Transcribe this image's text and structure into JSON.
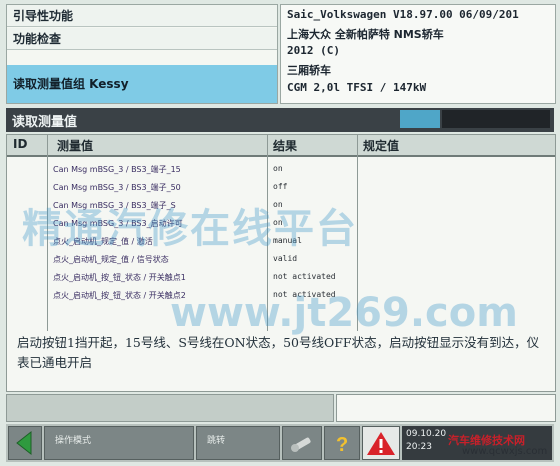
{
  "header": {
    "left": {
      "row1": "引导性功能",
      "row2": "功能检查",
      "row3": "读取测量值组 Kessy"
    },
    "right": {
      "line1": "Saic_Volkswagen  V18.97.00 06/09/201",
      "line2": "上海大众 全新帕萨特 NMS轿车",
      "line3": "2012 (C)",
      "line4": "三厢轿车",
      "line5": "CGM 2,0l TFSI / 147kW"
    }
  },
  "titlebar": {
    "title": "读取测量值"
  },
  "table": {
    "headers": {
      "id": "ID",
      "measure": "测量值",
      "result": "结果",
      "spec": "规定值"
    },
    "rows": [
      {
        "measure": "Can Msg mBSG_3 / BS3_端子_15",
        "result": "on"
      },
      {
        "measure": "Can Msg mBSG_3 / BS3_端子_50",
        "result": "off"
      },
      {
        "measure": "Can Msg mBSG_3 / BS3_端子_S",
        "result": "on"
      },
      {
        "measure": "Can Msg mBSG_3 / BS3_启动许可",
        "result": "on"
      },
      {
        "measure": "点火_启动机_规定_值 / 激活",
        "result": "manual"
      },
      {
        "measure": "点火_启动机_规定_值 / 信号状态",
        "result": "valid"
      },
      {
        "measure": "点火_启动机_按_钮_状态 / 开关触点1",
        "result": "not activated"
      },
      {
        "measure": "点火_启动机_按_钮_状态 / 开关触点2",
        "result": "not activated"
      }
    ],
    "note": "启动按钮1挡开起，15号线、S号线在ON状态，50号线OFF状态，启动按钮显示没有到达，仪表已通电开启"
  },
  "watermark": {
    "line1": "精通汽修在线平台",
    "line2": "www.jt269.com"
  },
  "toolbar": {
    "btn1_label": "操作模式",
    "btn2_label": "跳转",
    "clock_line1": "09.10.20",
    "clock_line2": "20:23"
  },
  "site_tag": {
    "line1": "汽车维修技术网",
    "line2": "www.qcwxjs.com"
  },
  "colors": {
    "selected_row": "#7fcbe6",
    "titlebar": "#3a4146",
    "warning": "#d9232a"
  }
}
